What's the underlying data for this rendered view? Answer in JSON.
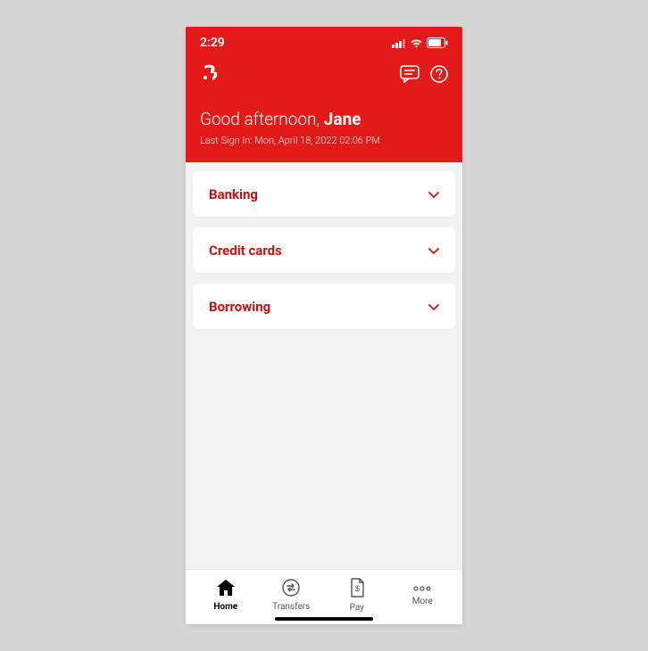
{
  "statusbar": {
    "time": "2:29"
  },
  "greeting": {
    "prefix": "Good afternoon, ",
    "name": "Jane"
  },
  "last_sign_in": "Last Sign In: Mon, April 18, 2022  02:06 PM",
  "sections": [
    {
      "title": "Banking"
    },
    {
      "title": "Credit cards"
    },
    {
      "title": "Borrowing"
    }
  ],
  "tabs": {
    "home": "Home",
    "transfers": "Transfers",
    "pay": "Pay",
    "more": "More"
  },
  "colors": {
    "brand": "#e31a1a"
  }
}
